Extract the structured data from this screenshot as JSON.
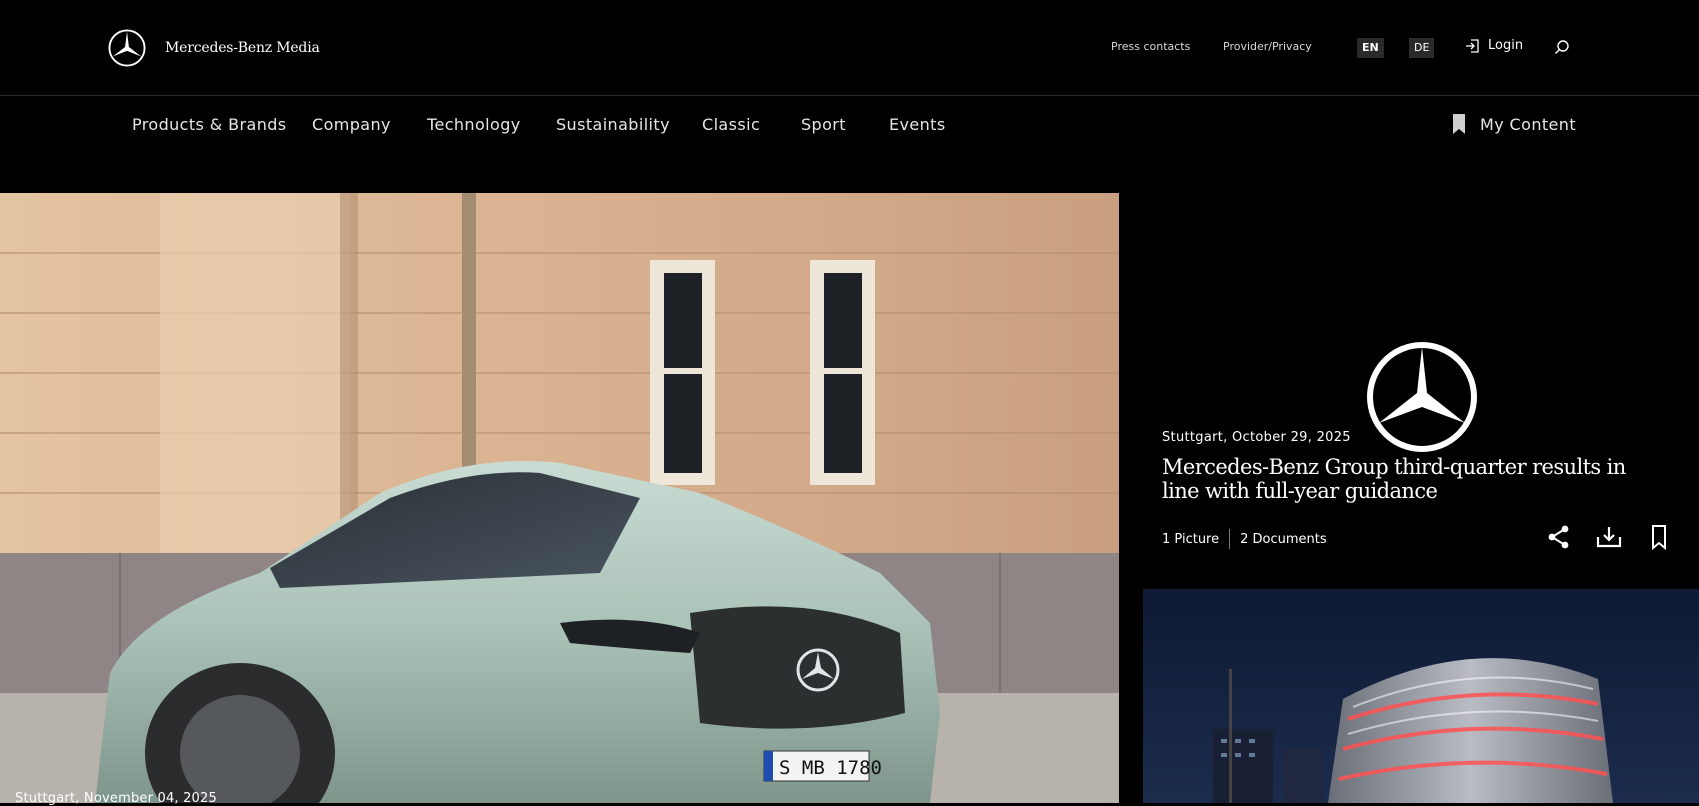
{
  "header": {
    "brand_name": "Mercedes-Benz Media",
    "links": [
      "Press contacts",
      "Provider/Privacy"
    ],
    "languages": [
      {
        "code": "EN",
        "active": true
      },
      {
        "code": "DE",
        "active": false
      }
    ],
    "login_label": "Login"
  },
  "nav": {
    "items": [
      "Products & Brands",
      "Company",
      "Technology",
      "Sustainability",
      "Classic",
      "Sport",
      "Events"
    ],
    "my_content_label": "My Content"
  },
  "hero": {
    "caption": "Stuttgart, November 04, 2025",
    "plate_text": "S MB 1780"
  },
  "article": {
    "meta": "Stuttgart, October 29, 2025",
    "title": "Mercedes-Benz Group third-quarter results in line with full-year guidance",
    "pictures": "1 Picture",
    "documents": "2 Documents",
    "actions": [
      "share-icon",
      "download-icon",
      "bookmark-icon"
    ]
  },
  "colors": {
    "background": "#000000",
    "lang_bg": "#2a2a2a",
    "text": "#ffffff"
  }
}
